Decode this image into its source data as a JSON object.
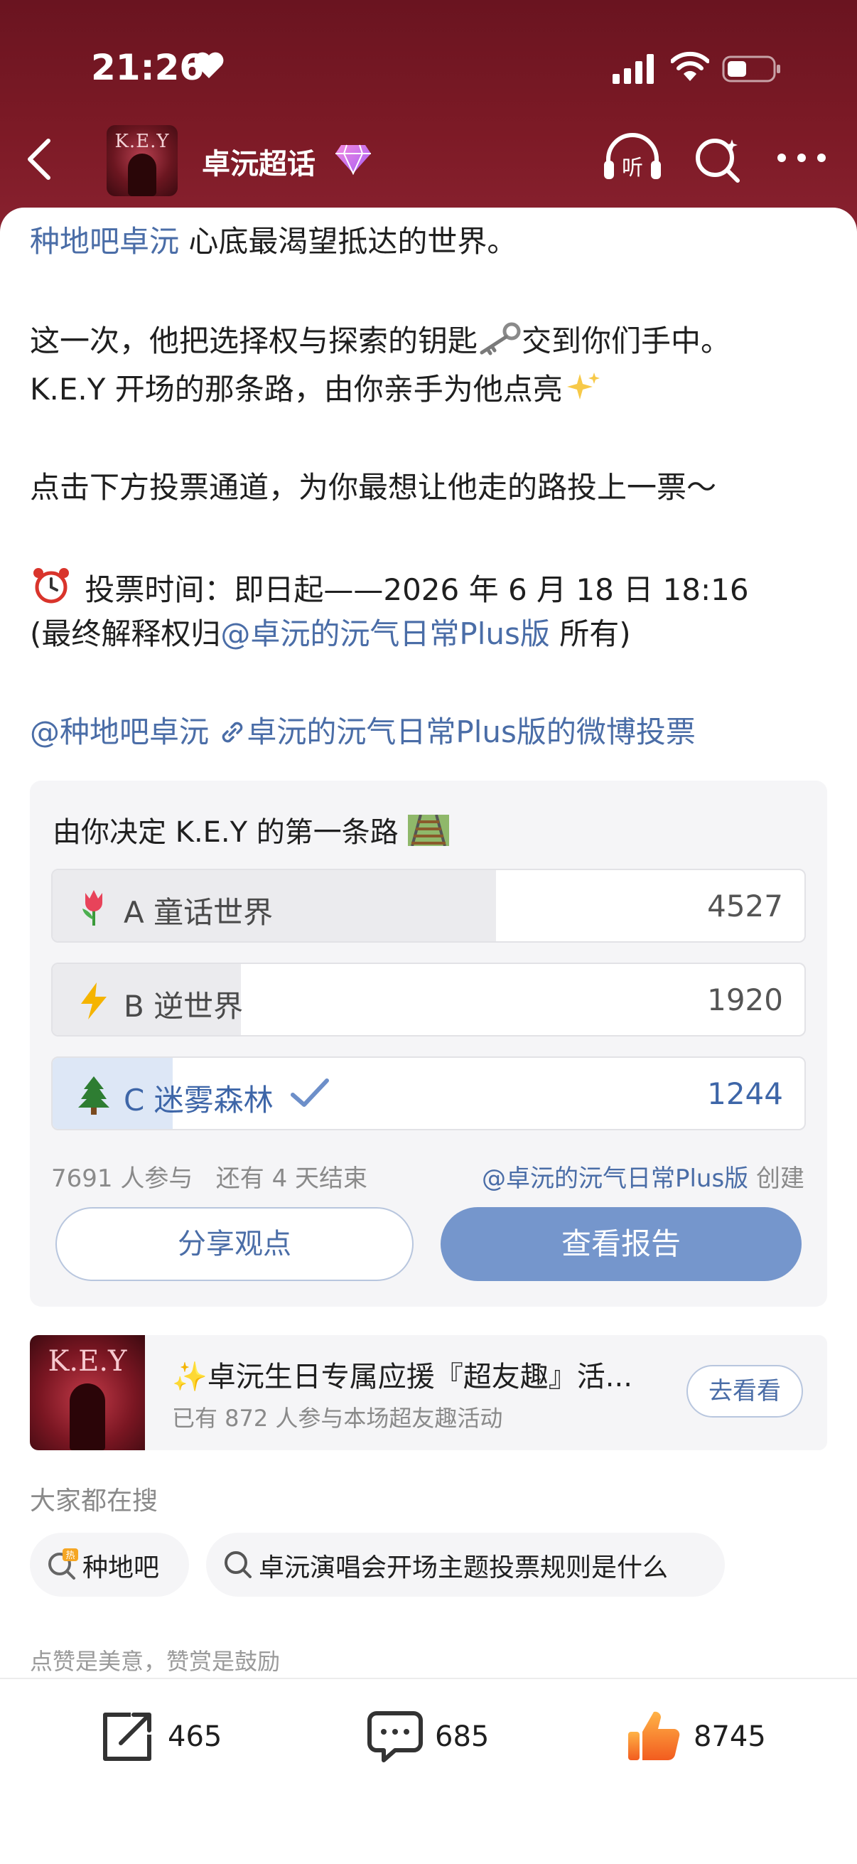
{
  "status_bar": {
    "time": "21:26"
  },
  "header": {
    "title": "卓沅超话",
    "avatar_text": "K.E.Y"
  },
  "post": {
    "line1_link": "种地吧卓沅",
    "line1_rest": " 心底最渴望抵达的世界。",
    "line2": "这一次，他把选择权与探索的钥匙",
    "line2_tail": "交到你们手中。",
    "line3": "K.E.Y 开场的那条路，由你亲手为他点亮",
    "line4": "点击下方投票通道，为你最想让他走的路投上一票～",
    "line5": "投票时间：即日起——2026 年 6 月 18 日 18:16",
    "line6_pre": "(最终解释权归",
    "line6_link": "@卓沅的沅气日常Plus版",
    "line6_post": " 所有)",
    "mention": "@种地吧卓沅",
    "vote_link": "卓沅的沅气日常Plus版的微博投票"
  },
  "poll": {
    "title": "由你决定 K.E.Y 的第一条路",
    "options": [
      {
        "label": "A 童话世界",
        "count": "4527",
        "fraction": 0.59,
        "emoji": "tulip"
      },
      {
        "label": "B 逆世界",
        "count": "1920",
        "fraction": 0.25,
        "emoji": "lightning"
      },
      {
        "label": "C 迷雾森林",
        "count": "1244",
        "fraction": 0.16,
        "emoji": "tree",
        "selected": true
      }
    ],
    "participants": "7691 人参与",
    "remaining": "还有 4 天结束",
    "creator": "@卓沅的沅气日常Plus版",
    "creator_suffix": " 创建",
    "share_label": "分享观点",
    "report_label": "查看报告"
  },
  "activity": {
    "thumb_text": "K.E.Y",
    "title": "✨卓沅生日专属应援『超友趣』活...",
    "subtitle": "已有 872 人参与本场超友趣活动",
    "button": "去看看"
  },
  "searches": {
    "label": "大家都在搜",
    "items": [
      "种地吧",
      "卓沅演唱会开场主题投票规则是什么"
    ]
  },
  "footer_note": "点赞是美意，赞赏是鼓励",
  "actions": {
    "share": "465",
    "comment": "685",
    "like": "8745"
  },
  "colors": {
    "header": "#7d1a26",
    "link": "#4a6da7",
    "accent": "#7596cc",
    "like": "#f47b2a"
  }
}
